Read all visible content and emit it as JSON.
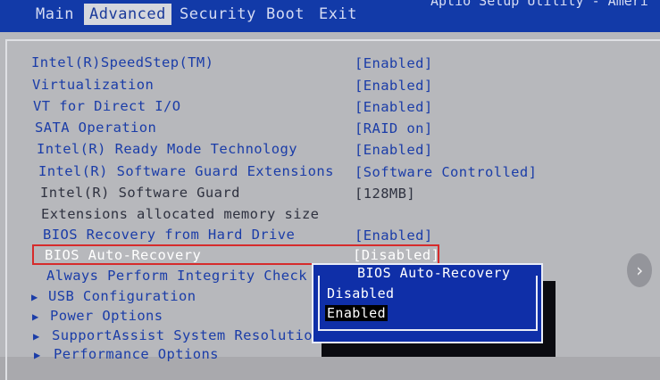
{
  "header": {
    "tabs": [
      "Main",
      "Advanced",
      "Security",
      "Boot",
      "Exit"
    ],
    "active_tab": "Advanced",
    "title": "Aptio Setup Utility - Ameri"
  },
  "settings": [
    {
      "label": "Intel(R)SpeedStep(TM)",
      "value": "[Enabled]"
    },
    {
      "label": "Virtualization",
      "value": "[Enabled]"
    },
    {
      "label": "VT for Direct I/O",
      "value": "[Enabled]"
    },
    {
      "label": "SATA Operation",
      "value": "[RAID on]"
    },
    {
      "label": "Intel(R) Ready Mode Technology",
      "value": "[Enabled]"
    },
    {
      "label": "Intel(R) Software Guard Extensions",
      "value": "[Software Controlled]"
    },
    {
      "label": "Intel(R) Software Guard",
      "value": "[128MB]"
    },
    {
      "label": "Extensions allocated memory size",
      "value": ""
    },
    {
      "label": "BIOS Recovery from Hard Drive",
      "value": "[Enabled]"
    },
    {
      "label": "BIOS Auto-Recovery",
      "value": "[Disabled]"
    },
    {
      "label": "Always Perform Integrity Check",
      "value": ""
    }
  ],
  "submenus": [
    "USB Configuration",
    "Power Options",
    "SupportAssist System Resolution",
    "Performance Options"
  ],
  "popup": {
    "title": "BIOS Auto-Recovery",
    "options": [
      "Disabled",
      "Enabled"
    ],
    "selected": "Enabled"
  },
  "colors": {
    "bar": "#123aa8",
    "text": "#1b3da8",
    "highlight_border": "#d62b2b",
    "popup_bg": "#0f2fa8"
  },
  "icons": {
    "submenu_arrow": "triangle-right",
    "nav_button": "chevron-right"
  }
}
